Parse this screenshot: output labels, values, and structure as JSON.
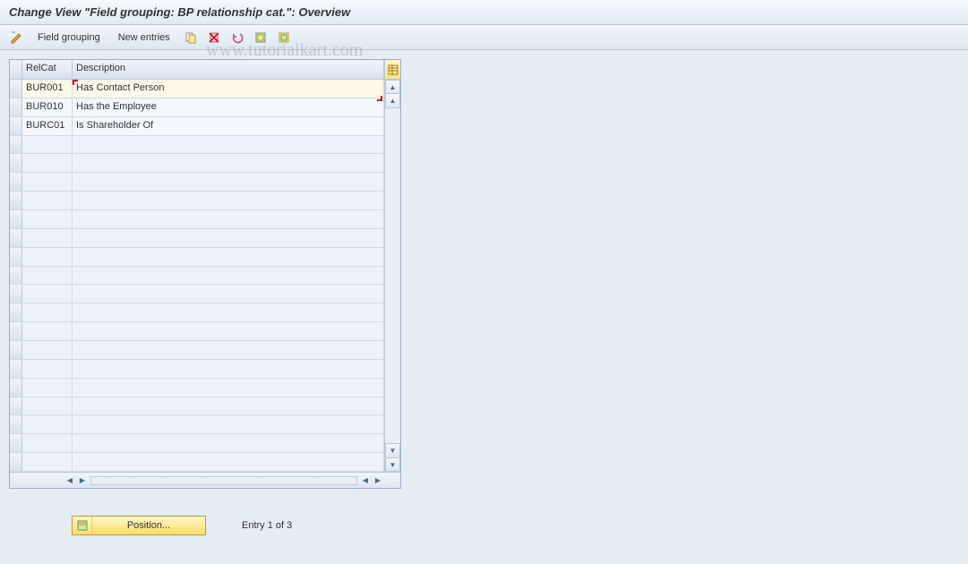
{
  "title": "Change View \"Field grouping: BP relationship cat.\": Overview",
  "toolbar": {
    "edit_icon": "pencil-ruler-icon",
    "field_grouping": "Field grouping",
    "new_entries": "New entries",
    "icons": [
      "copy-icon",
      "delete-icon",
      "undo-icon",
      "select-all-icon",
      "deselect-all-icon"
    ]
  },
  "table": {
    "columns": {
      "relcat": "RelCat",
      "description": "Description"
    },
    "rows": [
      {
        "relcat": "BUR001",
        "description": "Has Contact Person"
      },
      {
        "relcat": "BUR010",
        "description": "Has the Employee"
      },
      {
        "relcat": "BURC01",
        "description": "Is Shareholder Of"
      }
    ],
    "total_visible_rows": 21
  },
  "footer": {
    "position_label": "Position...",
    "entry_text": "Entry 1 of 3"
  },
  "watermark": "www.tutorialkart.com"
}
